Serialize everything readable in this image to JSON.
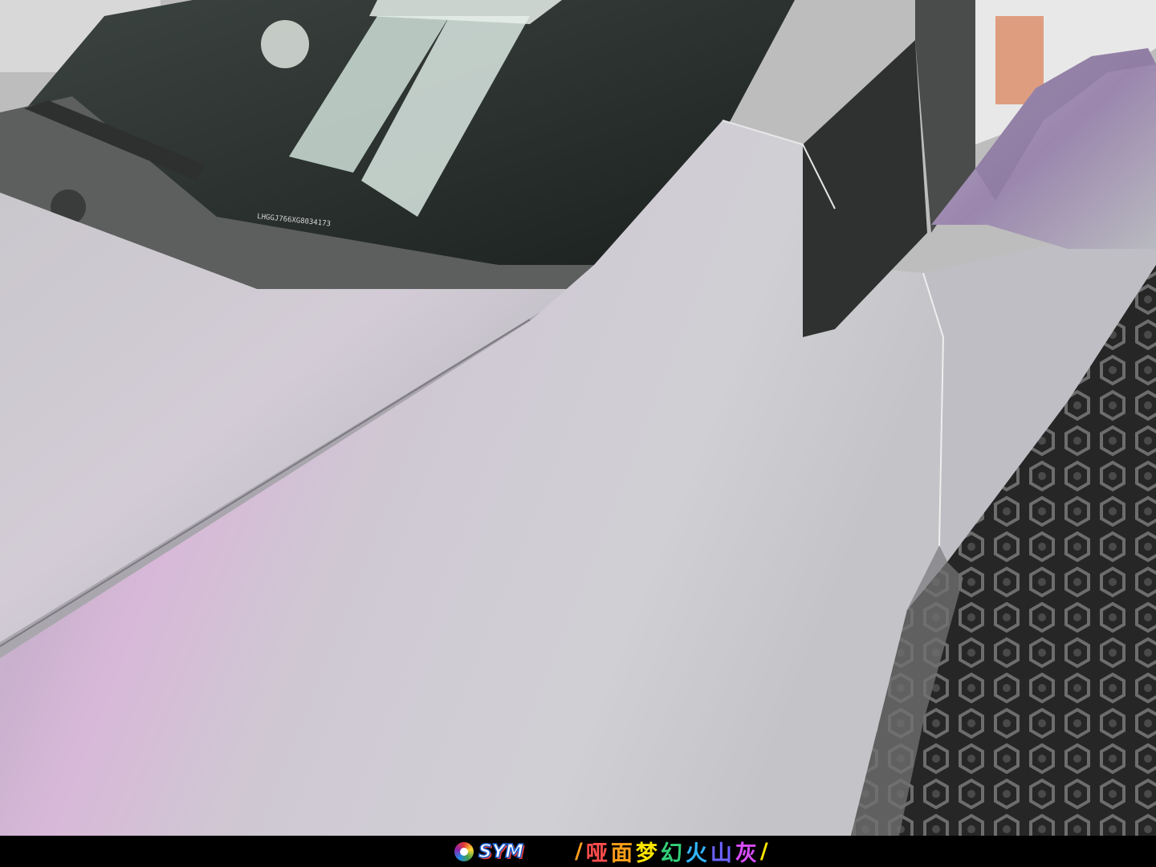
{
  "photo": {
    "subject": "car-body-panel-wrap",
    "vin_sticker_text": "LHGGJ766XG8034173",
    "colors": {
      "panel_base": "#c7c6cb",
      "panel_pink": "#d9b6d8",
      "glass_dark": "#1f2523",
      "floor_dark": "#2a2a2a",
      "trim_dark": "#2f3130"
    }
  },
  "caption": {
    "logo_text": "SYM",
    "title_text": "哑面梦幻火山灰",
    "separator": "/",
    "rainbow_colors": [
      "#ff4d4d",
      "#ff9f1a",
      "#ffe600",
      "#33d17a",
      "#33b5ff",
      "#6c63ff",
      "#d94dff"
    ]
  }
}
